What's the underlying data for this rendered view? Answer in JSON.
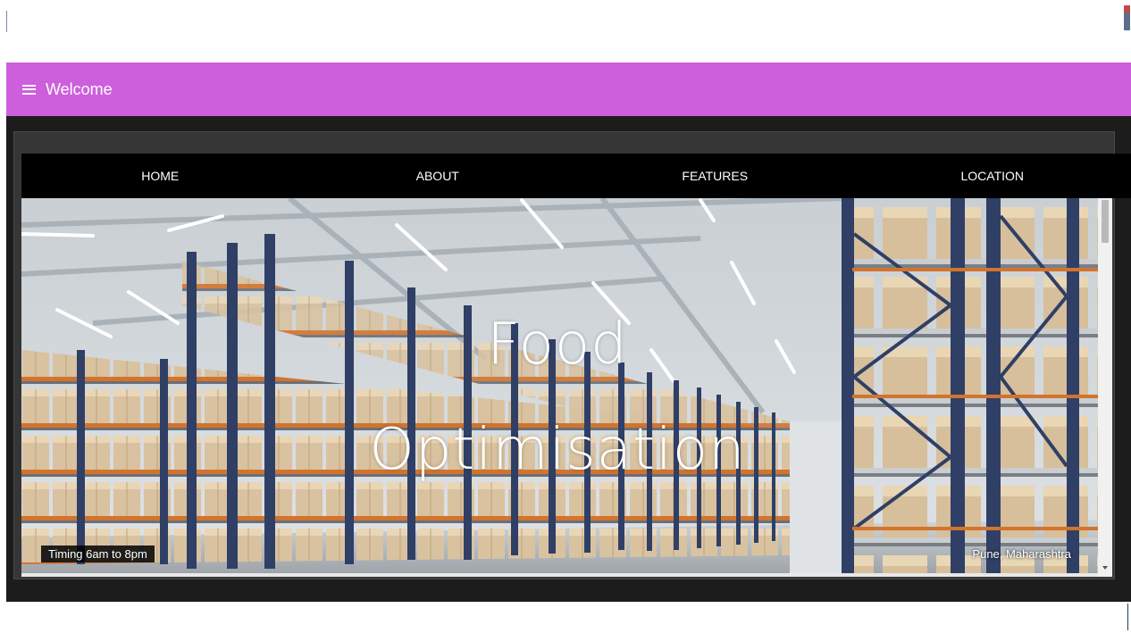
{
  "appbar": {
    "title": "Welcome",
    "icon": "menu-icon",
    "color": "#cd5fdc"
  },
  "nav": {
    "items": [
      "HOME",
      "ABOUT",
      "FEATURES",
      "LOCATION"
    ]
  },
  "hero": {
    "title_line1": "Food",
    "title_line2": "Optimisation",
    "timing": "Timing 6am to 8pm",
    "location": "Pune, Maharashtra"
  }
}
